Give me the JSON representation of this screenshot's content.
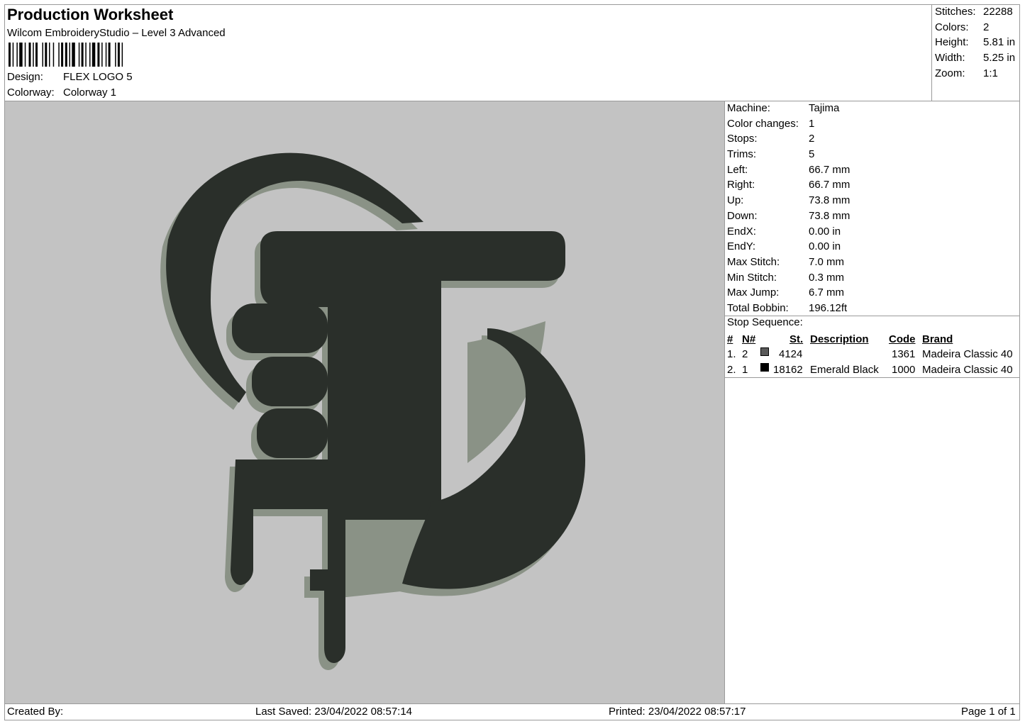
{
  "header": {
    "title": "Production Worksheet",
    "subtitle": "Wilcom EmbroideryStudio – Level 3 Advanced",
    "design_label": "Design:",
    "design_value": "FLEX LOGO 5",
    "colorway_label": "Colorway:",
    "colorway_value": "Colorway 1"
  },
  "stats": [
    {
      "label": "Stitches:",
      "value": "22288"
    },
    {
      "label": "Colors:",
      "value": "2"
    },
    {
      "label": "Height:",
      "value": "5.81 in"
    },
    {
      "label": "Width:",
      "value": "5.25 in"
    },
    {
      "label": "Zoom:",
      "value": "1:1"
    }
  ],
  "machine_info": [
    {
      "label": "Machine:",
      "value": "Tajima"
    },
    {
      "label": "Color changes:",
      "value": "1"
    },
    {
      "label": "Stops:",
      "value": "2"
    },
    {
      "label": "Trims:",
      "value": "5"
    },
    {
      "label": "Left:",
      "value": "66.7 mm"
    },
    {
      "label": "Right:",
      "value": "66.7 mm"
    },
    {
      "label": "Up:",
      "value": "73.8 mm"
    },
    {
      "label": "Down:",
      "value": "73.8 mm"
    },
    {
      "label": "EndX:",
      "value": "0.00 in"
    },
    {
      "label": "EndY:",
      "value": "0.00 in"
    },
    {
      "label": "Max Stitch:",
      "value": "7.0 mm"
    },
    {
      "label": "Min Stitch:",
      "value": "0.3 mm"
    },
    {
      "label": "Max Jump:",
      "value": "6.7 mm"
    },
    {
      "label": "Total Bobbin:",
      "value": "196.12ft"
    }
  ],
  "stop_sequence": {
    "label": "Stop Sequence:",
    "columns": {
      "num": "#",
      "needle": "N#",
      "stitches": "St.",
      "description": "Description",
      "code": "Code",
      "brand": "Brand"
    },
    "rows": [
      {
        "num": "1.",
        "needle": "2",
        "color": "#5a5a5a",
        "stitches": "4124",
        "description": "",
        "code": "1361",
        "brand": "Madeira Classic 40"
      },
      {
        "num": "2.",
        "needle": "1",
        "color": "#000000",
        "stitches": "18162",
        "description": "Emerald Black",
        "code": "1000",
        "brand": "Madeira Classic 40"
      }
    ]
  },
  "footer": {
    "created_by": "Created By:",
    "last_saved": "Last Saved: 23/04/2022 08:57:14",
    "printed": "Printed: 23/04/2022 08:57:17",
    "page": "Page 1 of 1"
  },
  "colors": {
    "canvas_bg": "#c3c3c3",
    "thread_dark": "#2a2f2a",
    "thread_light": "#8a9286"
  }
}
